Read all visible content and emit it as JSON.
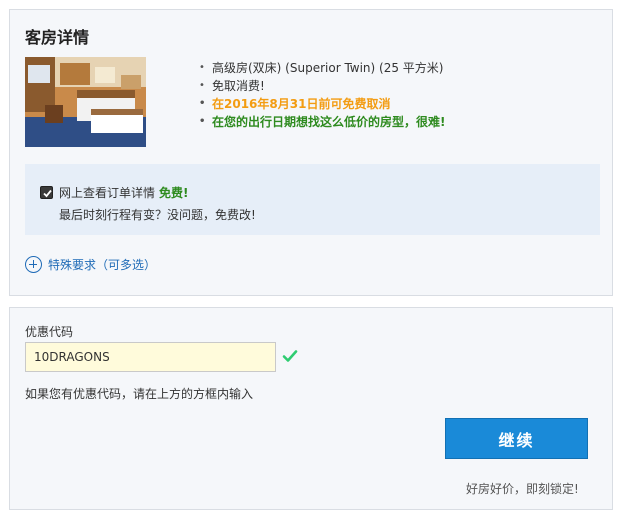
{
  "room_details": {
    "title": "客房详情",
    "items": [
      "高级房(双床) (Superior Twin) (25 平方米)",
      "免取消费!",
      "在2016年8月31日前可免费取消",
      "在您的出行日期想找这么低价的房型，很难!"
    ],
    "notice": {
      "line1": "网上查看订单详情",
      "free_label": "免费!",
      "line2": "最后时刻行程有变？没问题，免费改!"
    },
    "special_requests_label": "特殊要求（可多选）"
  },
  "promo": {
    "label": "优惠代码",
    "code_value": "10DRAGONS",
    "hint": "如果您有优惠代码，请在上方的方框内输入"
  },
  "actions": {
    "continue_label": "继续",
    "tagline": "好房好价，即刻锁定!"
  },
  "colors": {
    "accent_blue": "#1a8ad8",
    "promo_orange": "#f39c12",
    "positive_green": "#2e8b1f"
  }
}
